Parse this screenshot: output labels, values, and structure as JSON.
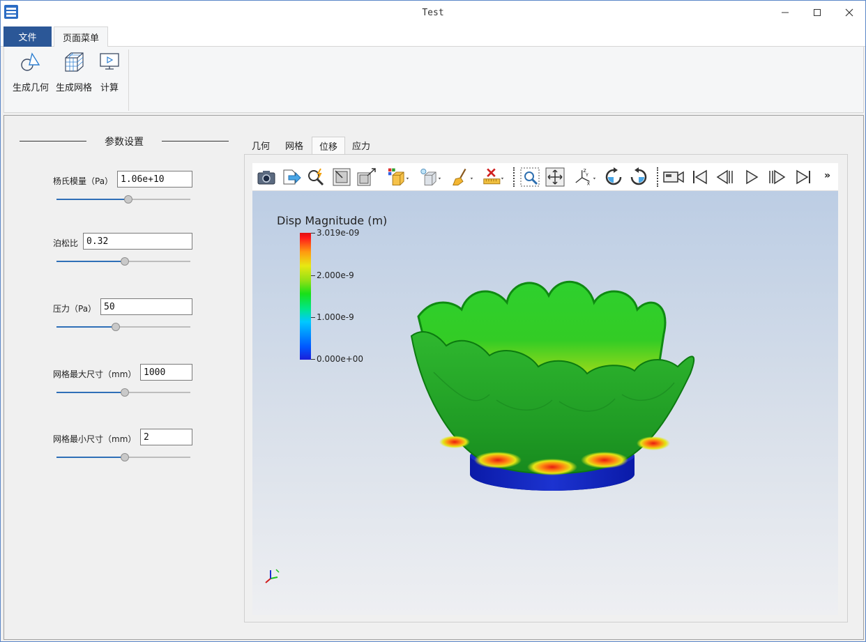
{
  "window": {
    "title": "Test"
  },
  "menubar": {
    "file": "文件",
    "page_menu": "页面菜单"
  },
  "ribbon": {
    "gen_geometry": "生成几何",
    "gen_mesh": "生成网格",
    "calculate": "计算"
  },
  "params": {
    "title": "参数设置",
    "items": [
      {
        "label": "杨氏模量（Pa）",
        "value": "1.06e+10",
        "slider": 0.54
      },
      {
        "label": "泊松比",
        "value": "0.32",
        "slider": 0.51
      },
      {
        "label": "压力（Pa）",
        "value": "50",
        "slider": 0.44
      },
      {
        "label": "网格最大尺寸（mm）",
        "value": "1000",
        "slider": 0.51
      },
      {
        "label": "网格最小尺寸（mm）",
        "value": "2",
        "slider": 0.51
      }
    ]
  },
  "tabs": [
    "几何",
    "网格",
    "位移",
    "应力"
  ],
  "active_tab": "位移",
  "toolbar": {
    "more": "»"
  },
  "viewport": {
    "legend_title": "Disp Magnitude (m)",
    "ticks": [
      "3.019e-09",
      "2.000e-9",
      "1.000e-9",
      "0.000e+00"
    ],
    "colors": {
      "max": "#e01010",
      "mid": "#18e018",
      "min": "#1c1ed8"
    }
  }
}
